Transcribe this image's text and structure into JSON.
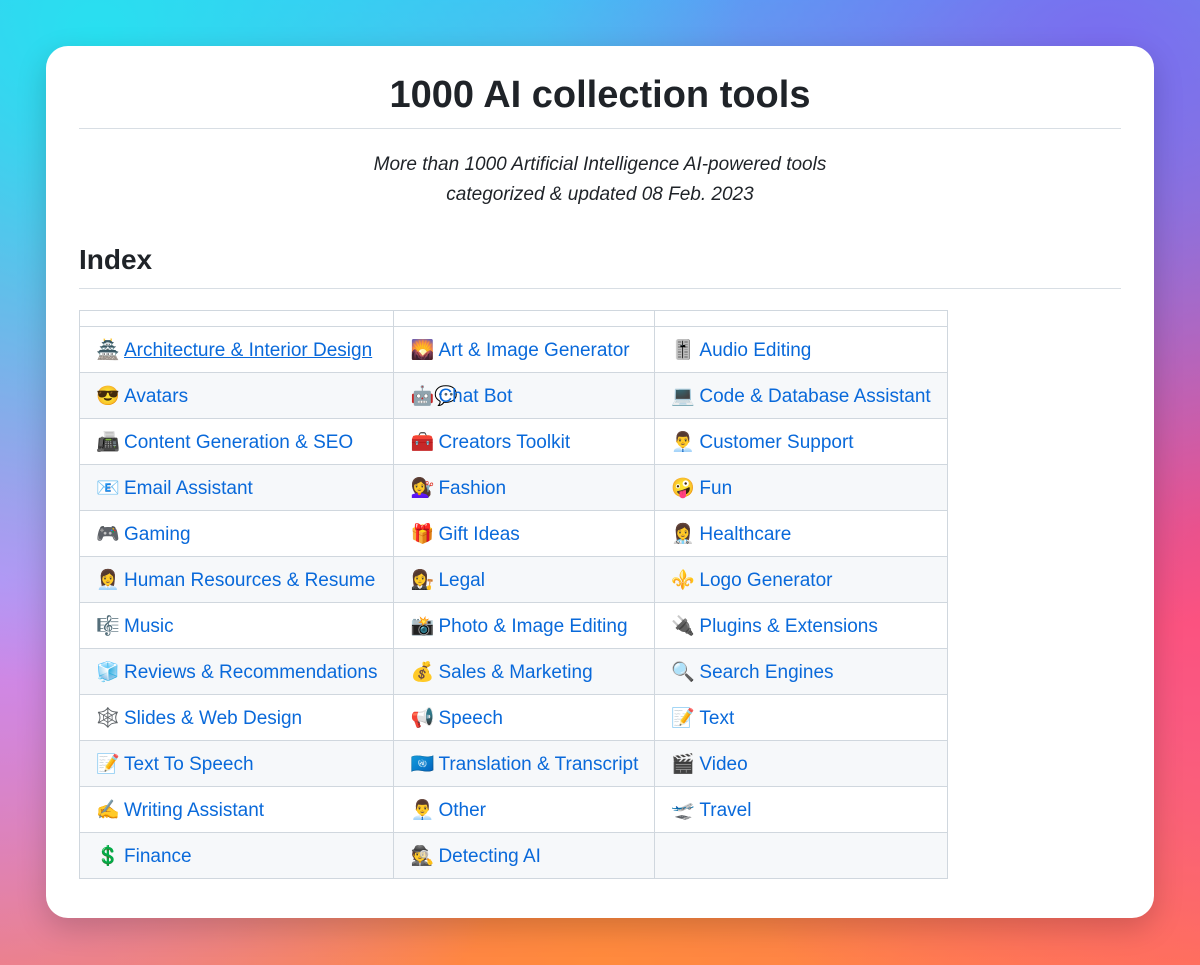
{
  "page": {
    "title": "1000 AI collection tools",
    "subtitle_line1": "More than 1000 Artificial Intelligence AI-powered tools",
    "subtitle_line2": "categorized & updated 08 Feb. 2023",
    "index_heading": "Index"
  },
  "colors": {
    "link": "#0969da",
    "text": "#1f2328",
    "border": "#d0d7de",
    "alt_row": "#f6f8fa"
  },
  "index": {
    "rows": [
      [
        {
          "emoji": "🏯",
          "label": "Architecture & Interior Design"
        },
        {
          "emoji": "🌄",
          "label": "Art & Image Generator"
        },
        {
          "emoji": "🎚️",
          "label": "Audio Editing"
        }
      ],
      [
        {
          "emoji": "😎",
          "label": "Avatars"
        },
        {
          "emoji": "🤖💬",
          "label": "Chat Bot"
        },
        {
          "emoji": "💻",
          "label": "Code & Database Assistant"
        }
      ],
      [
        {
          "emoji": "📠",
          "label": "Content Generation & SEO"
        },
        {
          "emoji": "🧰",
          "label": "Creators Toolkit"
        },
        {
          "emoji": "👨‍💼",
          "label": "Customer Support"
        }
      ],
      [
        {
          "emoji": "📧",
          "label": "Email Assistant"
        },
        {
          "emoji": "💇‍♀️",
          "label": "Fashion"
        },
        {
          "emoji": "🤪",
          "label": "Fun"
        }
      ],
      [
        {
          "emoji": "🎮",
          "label": "Gaming"
        },
        {
          "emoji": "🎁",
          "label": "Gift Ideas"
        },
        {
          "emoji": "👩‍⚕️",
          "label": "Healthcare"
        }
      ],
      [
        {
          "emoji": "👩‍💼",
          "label": "Human Resources & Resume"
        },
        {
          "emoji": "👩‍⚖️",
          "label": "Legal"
        },
        {
          "emoji": "⚜️",
          "label": "Logo Generator"
        }
      ],
      [
        {
          "emoji": "🎼",
          "label": "Music"
        },
        {
          "emoji": "📸",
          "label": "Photo & Image Editing"
        },
        {
          "emoji": "🔌",
          "label": "Plugins & Extensions"
        }
      ],
      [
        {
          "emoji": "🧊",
          "label": "Reviews & Recommendations"
        },
        {
          "emoji": "💰",
          "label": "Sales & Marketing"
        },
        {
          "emoji": "🔍",
          "label": "Search Engines"
        }
      ],
      [
        {
          "emoji": "🕸️",
          "label": "Slides & Web Design"
        },
        {
          "emoji": "📢",
          "label": "Speech"
        },
        {
          "emoji": "📝",
          "label": "Text"
        }
      ],
      [
        {
          "emoji": "📝",
          "label": "Text To Speech"
        },
        {
          "emoji": "🇺🇳",
          "label": "Translation & Transcript"
        },
        {
          "emoji": "🎬",
          "label": "Video"
        }
      ],
      [
        {
          "emoji": "✍️",
          "label": "Writing Assistant"
        },
        {
          "emoji": "👨‍💼",
          "label": "Other"
        },
        {
          "emoji": "🛫",
          "label": "Travel"
        }
      ],
      [
        {
          "emoji": "💲",
          "label": "Finance"
        },
        {
          "emoji": "🕵️",
          "label": "Detecting AI"
        },
        null
      ]
    ]
  }
}
